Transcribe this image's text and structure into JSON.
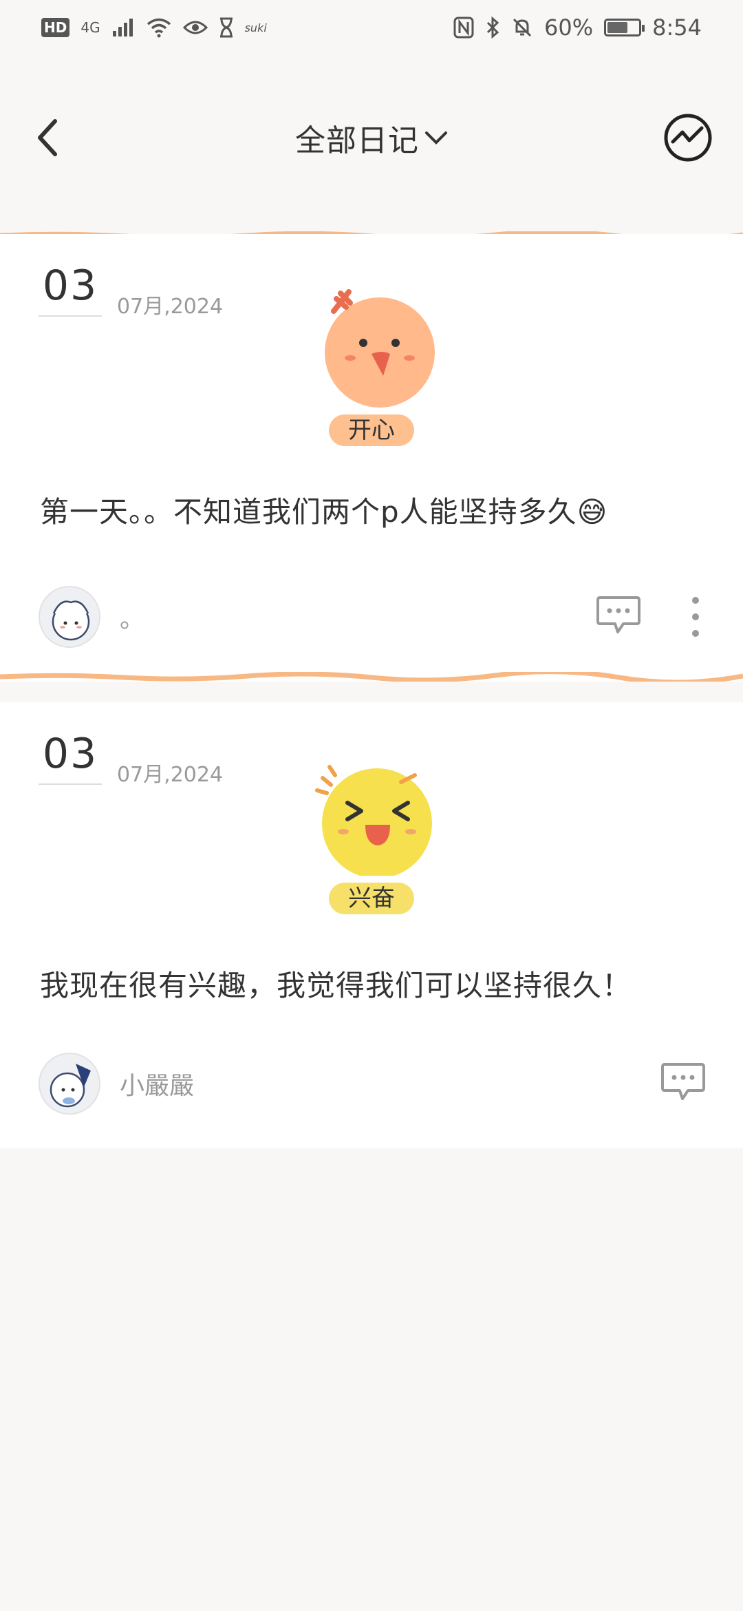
{
  "status_bar": {
    "network": "4G",
    "hd": "HD",
    "carrier_tag": "suki",
    "battery": "60%",
    "time": "8:54"
  },
  "header": {
    "title": "全部日记",
    "icons": {
      "back": "chevron-left-icon",
      "dropdown": "chevron-down-icon",
      "stats": "trend-chart-icon"
    }
  },
  "entries": [
    {
      "day": "03",
      "month_year": "07月,2024",
      "mood": "开心",
      "mood_color": "#ffc08f",
      "text": "第一天。。不知道我们两个p人能坚持多久😅",
      "author": "。",
      "divider_color": "#f7b883"
    },
    {
      "day": "03",
      "month_year": "07月,2024",
      "mood": "兴奋",
      "mood_color": "#f6e06a",
      "text": "我现在很有兴趣，我觉得我们可以坚持很久！",
      "author": "小嚴嚴"
    }
  ]
}
